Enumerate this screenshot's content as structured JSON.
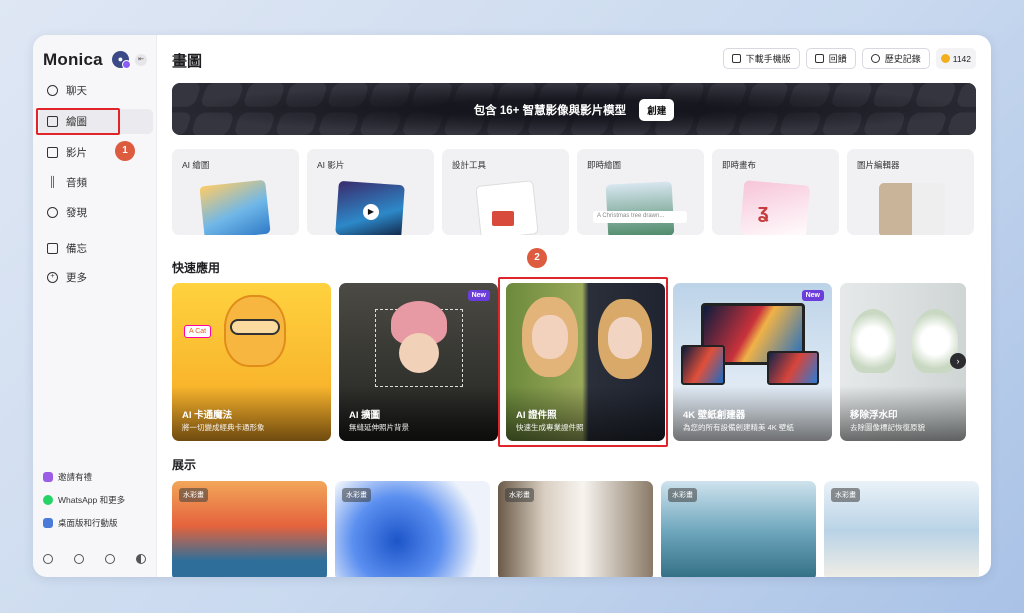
{
  "sidebar": {
    "brand": "Monica",
    "nav": [
      {
        "label": "聊天",
        "icon": "chat-icon"
      },
      {
        "label": "繪圖",
        "icon": "image-icon"
      },
      {
        "label": "影片",
        "icon": "video-icon"
      },
      {
        "label": "音頻",
        "icon": "audio-icon"
      },
      {
        "label": "發現",
        "icon": "compass-icon"
      },
      {
        "label": "備忘",
        "icon": "memo-icon"
      },
      {
        "label": "更多",
        "icon": "plus-circle-icon"
      }
    ],
    "footer": [
      {
        "label": "邀請有禮",
        "icon": "gift-icon",
        "color": "#9b5de5"
      },
      {
        "label": "WhatsApp 和更多",
        "icon": "whatsapp-icon",
        "color": "#25d366"
      },
      {
        "label": "桌面版和行動版",
        "icon": "devices-icon",
        "color": "#4a7bd8"
      }
    ]
  },
  "annotations": {
    "step1": "1",
    "step2": "2",
    "highlight_color": "#e0242a"
  },
  "header": {
    "title": "畫圖",
    "buttons": [
      {
        "label": "下載手機版",
        "icon": "phone-icon"
      },
      {
        "label": "回饋",
        "icon": "mail-icon"
      },
      {
        "label": "歷史記錄",
        "icon": "clock-icon"
      }
    ],
    "credits": "1142"
  },
  "banner": {
    "text": "包含 16+ 智慧影像與影片模型",
    "button": "創建"
  },
  "tools": [
    {
      "label": "AI 繪圖"
    },
    {
      "label": "AI 影片"
    },
    {
      "label": "設計工具"
    },
    {
      "label": "即時繪圖",
      "caption": "A Christmas tree drawn..."
    },
    {
      "label": "即時畫布"
    },
    {
      "label": "圖片編輯器"
    }
  ],
  "quick_apps_title": "快速應用",
  "quick_apps": [
    {
      "name": "AI 卡通魔法",
      "desc": "將一切變成經典卡通形象",
      "sticker": "A Cat"
    },
    {
      "name": "AI 擴圖",
      "desc": "無縫延伸照片背景",
      "tag": "New"
    },
    {
      "name": "AI 證件照",
      "desc": "快速生成專業證件照"
    },
    {
      "name": "4K 壁紙創建器",
      "desc": "為您的所有設備創建精美 4K 壁紙",
      "tag": "New"
    },
    {
      "name": "移除浮水印",
      "desc": "去除圖像標記恢復原貌"
    }
  ],
  "gallery_title": "展示",
  "gallery": [
    {
      "tag": "水彩畫"
    },
    {
      "tag": "水彩畫"
    },
    {
      "tag": "水彩畫"
    },
    {
      "tag": "水彩畫"
    },
    {
      "tag": "水彩畫"
    }
  ]
}
